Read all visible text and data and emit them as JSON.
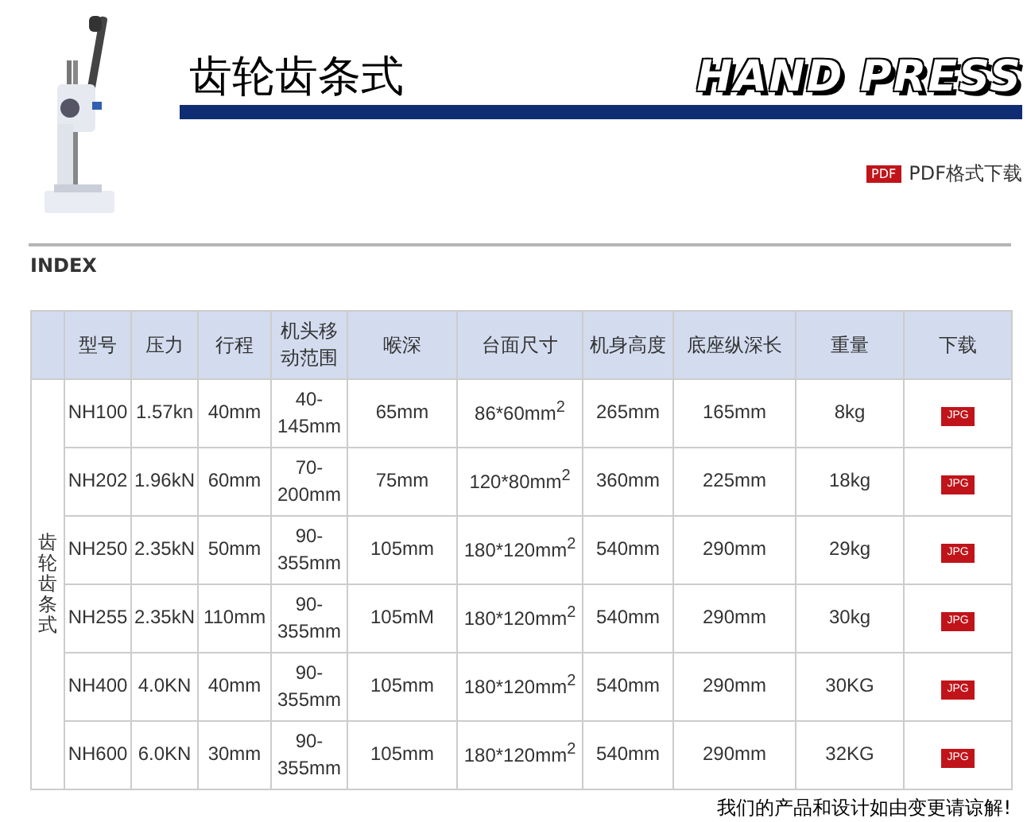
{
  "header": {
    "title": "齿轮齿条式",
    "logo": "HAND PRESS",
    "pdf_link": {
      "badge": "PDF",
      "label": "PDF格式下载"
    }
  },
  "section_label": "INDEX",
  "table": {
    "columns": [
      "",
      "型号",
      "压力",
      "行程",
      "机头移动范围",
      "喉深",
      "台面尺寸",
      "机身高度",
      "底座纵深长",
      "重量",
      "下载"
    ],
    "groups": [
      {
        "label": "齿轮齿条式",
        "rows": [
          {
            "cells": [
              "NH100",
              "1.57kn",
              "40mm",
              "40-145mm",
              "65mm",
              "86*60mm$^{2}$",
              "265mm",
              "165mm",
              "8kg"
            ],
            "download": "JPG"
          },
          {
            "cells": [
              "NH202",
              "1.96kN",
              "60mm",
              "70-200mm",
              "75mm",
              "120*80mm$^{2}$",
              "360mm",
              "225mm",
              "18kg"
            ],
            "download": "JPG"
          },
          {
            "cells": [
              "NH250",
              "2.35kN",
              "50mm",
              "90-355mm",
              "105mm",
              "180*120mm$^{2}$",
              "540mm",
              "290mm",
              "29kg"
            ],
            "download": "JPG"
          },
          {
            "cells": [
              "NH255",
              "2.35kN",
              "110mm",
              "90-355mm",
              "105mM",
              "180*120mm$^{2}$",
              "540mm",
              "290mm",
              "30kg"
            ],
            "download": "JPG"
          },
          {
            "cells": [
              "NH400",
              "4.0KN",
              "40mm",
              "90-355mm",
              "105mm",
              "180*120mm$^{2}$",
              "540mm",
              "290mm",
              "30KG"
            ],
            "download": "JPG"
          },
          {
            "cells": [
              "NH600",
              "6.0KN",
              "30mm",
              "90-355mm",
              "105mm",
              "180*120mm$^{2}$",
              "540mm",
              "290mm",
              "32KG"
            ],
            "download": "JPG"
          }
        ]
      }
    ]
  },
  "footer_note": "我们的产品和设计如由变更请谅解!"
}
